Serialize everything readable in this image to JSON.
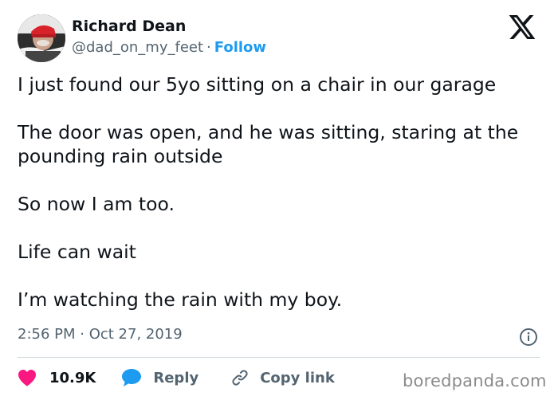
{
  "author": {
    "name": "Richard Dean",
    "handle": "@dad_on_my_feet",
    "separator": "·",
    "follow_label": "Follow"
  },
  "platform_icon": "x-logo-icon",
  "tweet": {
    "paragraphs": [
      "I just found our 5yo sitting on a chair in our garage",
      "The door was open, and he was sitting, staring at the pounding rain outside",
      "So now I am too.",
      "Life can wait",
      "I’m watching the rain with my boy."
    ],
    "timestamp": "2:56 PM · Oct 27, 2019"
  },
  "actions": {
    "like_count": "10.9K",
    "reply_label": "Reply",
    "copy_link_label": "Copy link"
  },
  "icons": {
    "like": "heart-icon",
    "reply": "speech-bubble-icon",
    "copy": "link-icon",
    "info": "info-icon"
  },
  "colors": {
    "text": "#0f1419",
    "secondary": "#536471",
    "accent": "#1d9bf0",
    "like": "#f91880",
    "divider": "#cfd9de",
    "watermark": "#8b8b8b"
  },
  "watermark": "boredpanda.com"
}
